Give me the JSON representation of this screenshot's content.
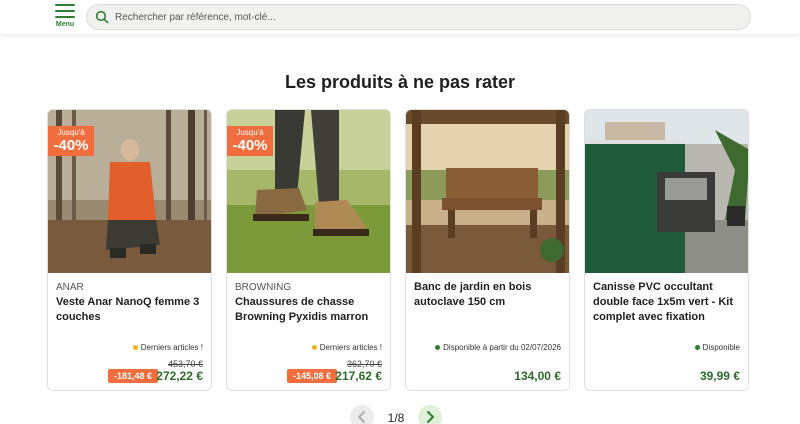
{
  "header": {
    "menu_label": "Menu",
    "search_placeholder": "Rechercher par référence, mot-clé..."
  },
  "section_title": "Les produits à ne pas rater",
  "colors": {
    "brand_green": "#2e7d32",
    "price_green": "#2e6b2a",
    "promo_orange": "#f26d3d",
    "stock_low": "#f2b21d",
    "stock_ok": "#2e7d32"
  },
  "products": [
    {
      "promo_line1": "Jusqu'à",
      "promo_line2": "-40%",
      "brand": "ANAR",
      "name": "Veste Anar NanoQ femme 3 couches",
      "availability": "Derniers articles !",
      "old_price": "453,70 €",
      "discount": "-181,48 €",
      "price": "272,22 €"
    },
    {
      "promo_line1": "Jusqu'à",
      "promo_line2": "-40%",
      "brand": "BROWNING",
      "name": "Chaussures de chasse Browning Pyxidis marron",
      "availability": "Derniers articles !",
      "old_price": "362,70 €",
      "discount": "-145,08 €",
      "price": "217,62 €"
    },
    {
      "name": "Banc de jardin en bois autoclave 150 cm",
      "availability": "Disponible à partir du 02/07/2026",
      "price": "134,00 €"
    },
    {
      "name": "Canisse PVC occultant double face 1x5m vert - Kit complet avec fixation",
      "availability": "Disponible",
      "price": "39,99 €"
    }
  ],
  "pagination": {
    "current": "1/8",
    "prev_icon": "chevron-left-icon",
    "next_icon": "chevron-right-icon"
  }
}
